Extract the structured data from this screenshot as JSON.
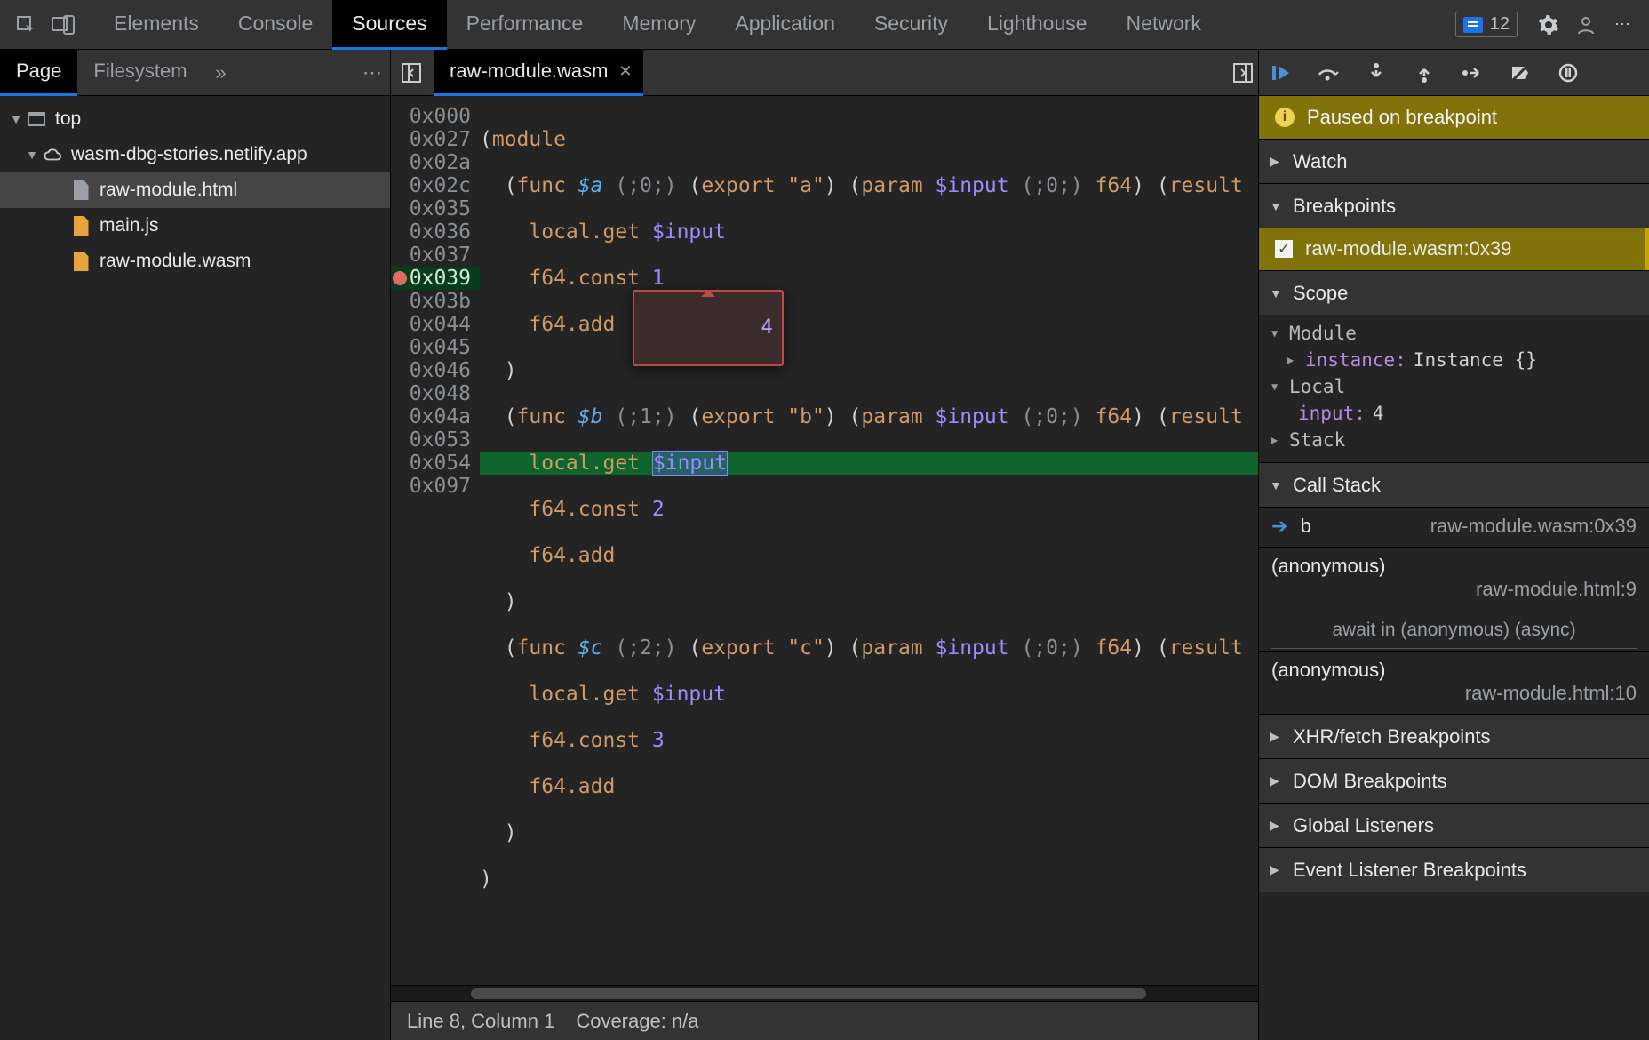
{
  "top_tabs": {
    "items": [
      "Elements",
      "Console",
      "Sources",
      "Performance",
      "Memory",
      "Application",
      "Security",
      "Lighthouse",
      "Network"
    ],
    "active": "Sources",
    "issues_count": "12"
  },
  "navigator": {
    "tabs": [
      "Page",
      "Filesystem"
    ],
    "active": "Page",
    "tree": {
      "top": "top",
      "origin": "wasm-dbg-stories.netlify.app",
      "files": [
        "raw-module.html",
        "main.js",
        "raw-module.wasm"
      ],
      "selected": "raw-module.html"
    }
  },
  "editor": {
    "file_name": "raw-module.wasm",
    "offsets": [
      "0x000",
      "0x027",
      "0x02a",
      "0x02c",
      "0x035",
      "0x036",
      "0x037",
      "0x039",
      "0x03b",
      "0x044",
      "0x045",
      "0x046",
      "0x048",
      "0x04a",
      "0x053",
      "0x054",
      "0x097"
    ],
    "breakpoint_index": 7,
    "current_index": 7,
    "tooltip_value": "4",
    "status_line": "Line 8, Column 1",
    "status_coverage": "Coverage: n/a",
    "tokens": {
      "module": "module",
      "func": "func",
      "export": "export",
      "param": "param",
      "result": "result",
      "lg": "local.get",
      "fc": "f64.const",
      "fa": "f64.add",
      "a": "$a",
      "b": "$b",
      "c": "$c",
      "inp": "$input",
      "ea": "\"a\"",
      "eb": "\"b\"",
      "ec": "\"c\"",
      "c0": "(;0;)",
      "c1": "(;1;)",
      "c2": "(;2;)",
      "f64": "f64",
      "n1": "1",
      "n2": "2",
      "n3": "3"
    }
  },
  "debugger": {
    "banner": "Paused on breakpoint",
    "sections": {
      "watch": "Watch",
      "breakpoints": "Breakpoints",
      "scope": "Scope",
      "callstack": "Call Stack",
      "xhr": "XHR/fetch Breakpoints",
      "dom": "DOM Breakpoints",
      "glob": "Global Listeners",
      "evt": "Event Listener Breakpoints"
    },
    "breakpoints": [
      {
        "label": "raw-module.wasm:0x39",
        "checked": true
      }
    ],
    "scope": {
      "module_label": "Module",
      "instance_key": "instance:",
      "instance_val": "Instance {}",
      "local_label": "Local",
      "local_key": "input:",
      "local_val": "4",
      "stack_label": "Stack"
    },
    "callstack": [
      {
        "name": "b",
        "loc": "raw-module.wasm:0x39",
        "current": true
      },
      {
        "name": "(anonymous)",
        "loc": "raw-module.html:9"
      },
      {
        "async": "await in (anonymous) (async)"
      },
      {
        "name": "(anonymous)",
        "loc": "raw-module.html:10"
      }
    ]
  }
}
